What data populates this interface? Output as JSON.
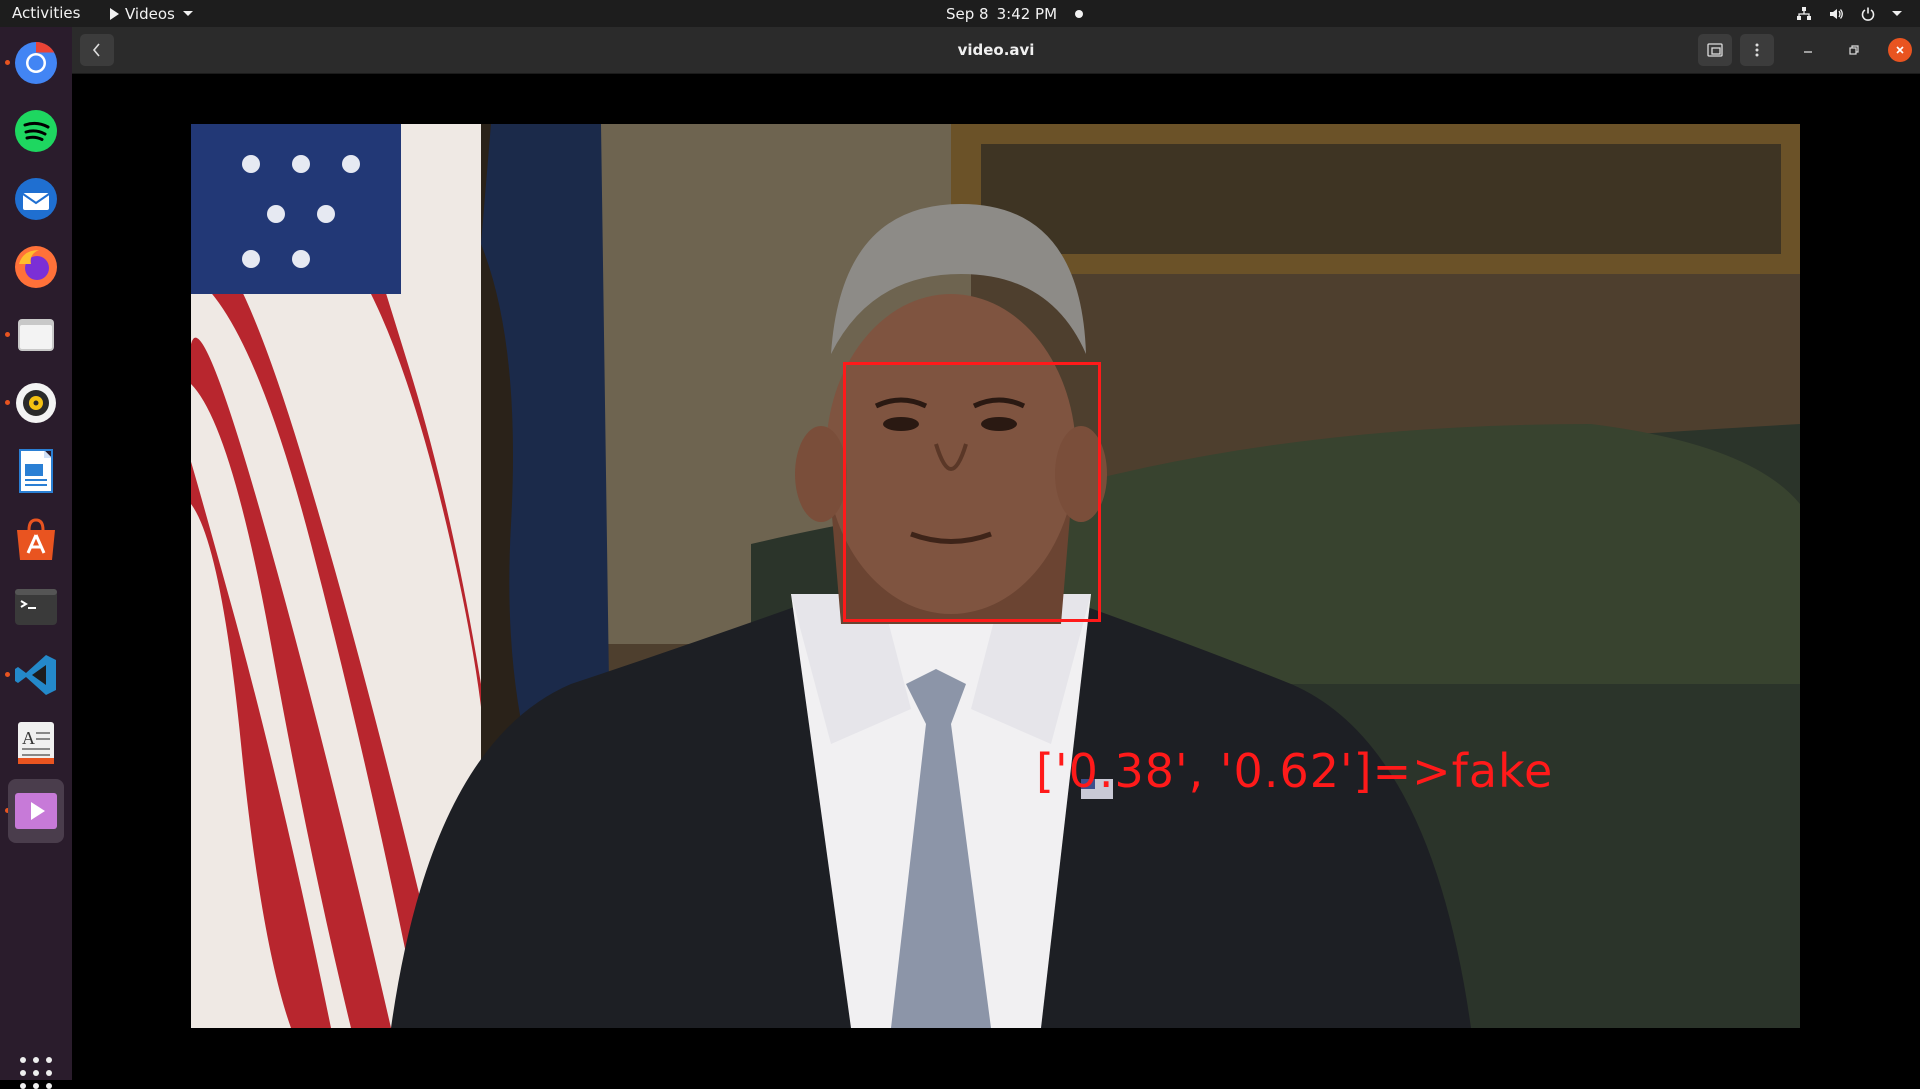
{
  "topbar": {
    "activities": "Activities",
    "app_name": "Videos",
    "date": "Sep 8",
    "time": "3:42 PM"
  },
  "dock": {
    "apps": [
      "chrome",
      "spotify",
      "thunderbird",
      "firefox",
      "files",
      "rhythmbox",
      "libreoffice-writer",
      "software-center",
      "terminal",
      "vscode",
      "text-editor",
      "videos"
    ],
    "accent": "#e95420"
  },
  "window": {
    "title": "video.avi"
  },
  "video": {
    "overlay_text": "['0.38', '0.62']=>fake",
    "box_color": "#ff1a1a"
  }
}
